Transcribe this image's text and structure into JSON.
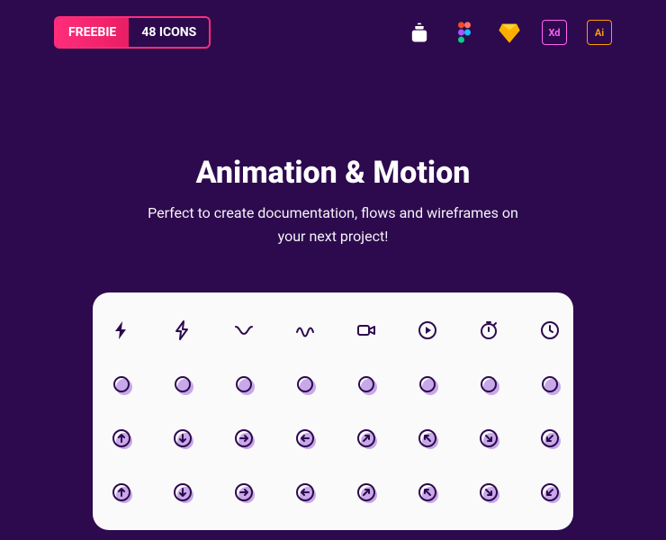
{
  "badge": {
    "left": "FREEBIE",
    "right": "48 ICONS"
  },
  "hero": {
    "title": "Animation & Motion",
    "subtitle": "Perfect to create documentation, flows  and wireframes on your next project!"
  },
  "apps": {
    "xd": "Xd",
    "ai": "Ai"
  },
  "icons": [
    "lightning-fill",
    "lightning-outline",
    "ease-curve",
    "bounce-curve",
    "video",
    "play-circle",
    "stopwatch",
    "clock",
    "circle",
    "circle",
    "circle",
    "circle",
    "circle",
    "circle",
    "circle",
    "circle",
    "arrow-circle-up",
    "arrow-circle-down",
    "arrow-circle-right",
    "arrow-circle-left",
    "arrow-circle-ne",
    "arrow-circle-nw",
    "arrow-circle-se",
    "arrow-circle-sw",
    "arrow-circle-up",
    "arrow-circle-down",
    "arrow-circle-right",
    "arrow-circle-left",
    "arrow-circle-ne",
    "arrow-circle-nw",
    "arrow-circle-se",
    "arrow-circle-sw"
  ]
}
